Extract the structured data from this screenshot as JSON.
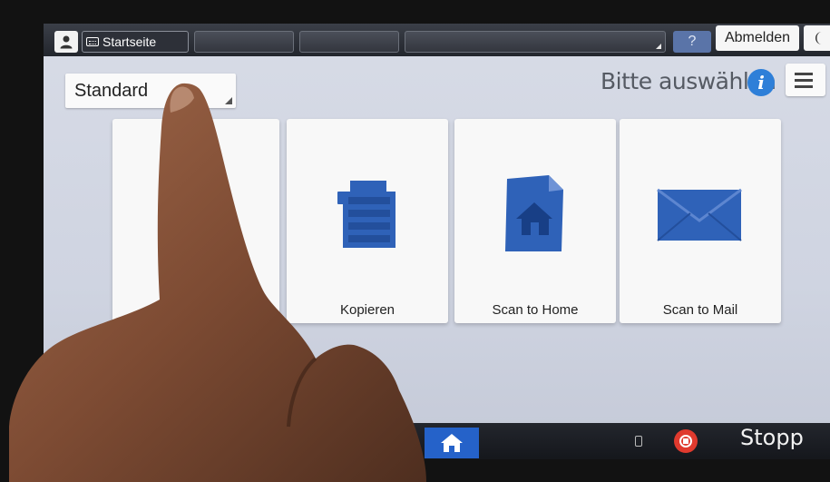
{
  "topbar": {
    "user_icon": "user-icon",
    "home_tab_label": "Startseite",
    "help_label": "?",
    "logout_label": "Abmelden",
    "energy_icon": "moon-icon"
  },
  "header": {
    "profile_selected": "Standard",
    "prompt": "Bitte auswählen",
    "info_icon": "i",
    "menu_icon": "hamburger-menu-icon"
  },
  "apps": [
    {
      "label": "",
      "icon": "hidden-app-icon"
    },
    {
      "label": "Kopieren",
      "icon": "copier-icon"
    },
    {
      "label": "Scan to Home",
      "icon": "house-folder-icon"
    },
    {
      "label": "Scan to Mail",
      "icon": "envelope-icon"
    }
  ],
  "bottombar": {
    "home_icon": "home-icon",
    "stop_label": "Stopp",
    "stop_icon": "stop-icon"
  },
  "colors": {
    "accent_blue": "#2562c9",
    "icon_blue": "#2f62b8",
    "stop_red": "#e03a2e",
    "info_blue": "#2e7fd8"
  }
}
